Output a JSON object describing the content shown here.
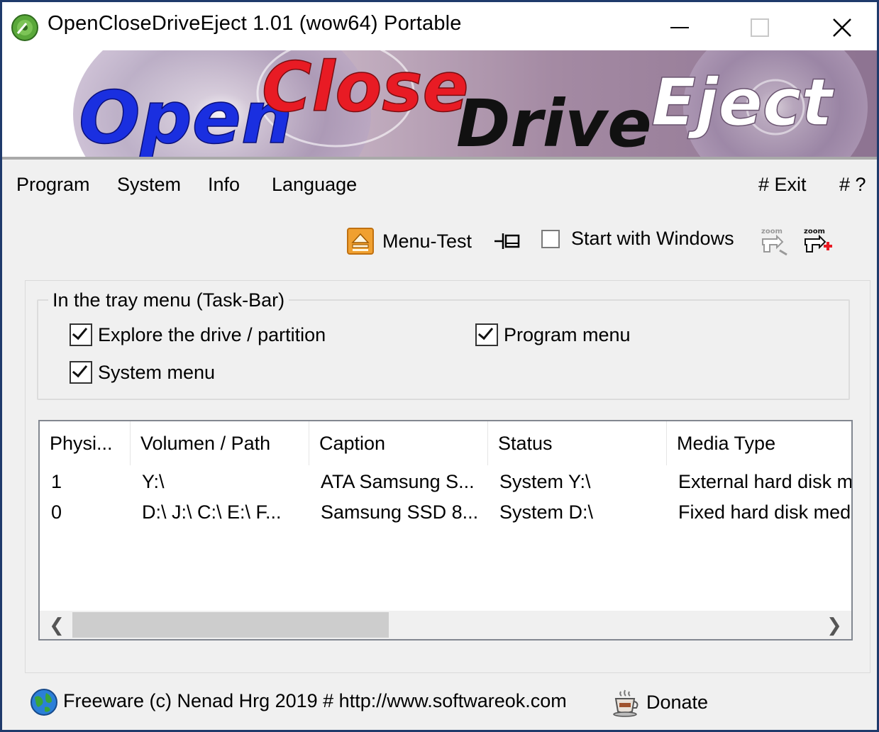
{
  "window": {
    "title": "OpenCloseDriveEject 1.01  (wow64) Portable"
  },
  "banner": {
    "word1": "Open",
    "word2": "Close",
    "word3": "Drive",
    "word4": "Eject"
  },
  "menu": {
    "program": "Program",
    "system": "System",
    "info": "Info",
    "language": "Language",
    "exit": "# Exit",
    "help": "# ?"
  },
  "toolbar": {
    "menu_test": "Menu-Test",
    "start_with_windows": "Start with Windows",
    "start_with_windows_checked": false,
    "zoom_out_icon": "zoom-out-icon",
    "zoom_in_icon": "zoom-in-icon"
  },
  "tray_group": {
    "legend": "In the tray menu (Task-Bar)",
    "options": [
      {
        "label": "Explore the drive / partition",
        "checked": true
      },
      {
        "label": "Program menu",
        "checked": true
      },
      {
        "label": "System menu",
        "checked": true
      }
    ]
  },
  "drive_list": {
    "columns": [
      "Physi...",
      "Volumen / Path",
      "Caption",
      "Status",
      "Media Type"
    ],
    "rows": [
      [
        "1",
        "Y:\\",
        "ATA Samsung S...",
        "System Y:\\",
        "External hard disk m"
      ],
      [
        "0",
        "D:\\ J:\\ C:\\ E:\\ F...",
        "Samsung SSD 8...",
        "System D:\\",
        "Fixed hard disk medi"
      ]
    ]
  },
  "footer": {
    "copyright": "Freeware (c) Nenad Hrg 2019 # http://www.softwareok.com",
    "donate": "Donate"
  },
  "colors": {
    "title_bar": "#ffffff",
    "window_bg": "#f0f0f0",
    "outer_frame": "#1f3a6b",
    "open_blue": "#1a2fe0",
    "close_red": "#e81b24",
    "drive_black": "#111111",
    "menu_test_icon": "#f0a030"
  }
}
